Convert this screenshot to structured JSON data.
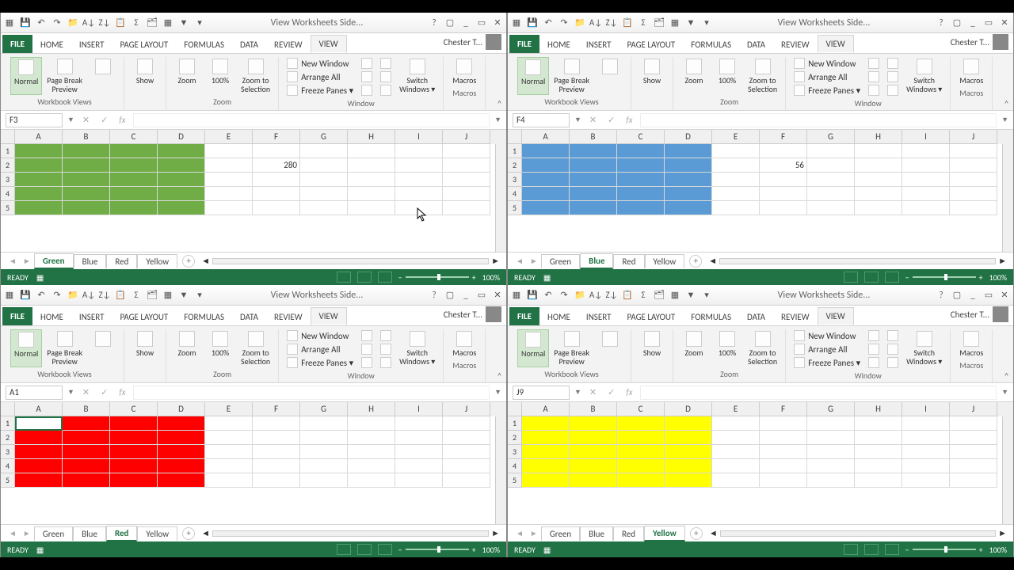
{
  "title_text": "View Worksheets Side...",
  "user_name": "Chester T...",
  "tabs_ribbon": [
    "FILE",
    "HOME",
    "INSERT",
    "PAGE LAYOUT",
    "FORMULAS",
    "DATA",
    "REVIEW",
    "VIEW"
  ],
  "active_ribbon_tab": "VIEW",
  "ribbon": {
    "group_views": "Workbook Views",
    "group_zoom": "Zoom",
    "group_window": "Window",
    "group_macros": "Macros",
    "normal": "Normal",
    "page_break": "Page Break\nPreview",
    "show": "Show",
    "zoom": "Zoom",
    "pct100": "100%",
    "zoom_sel": "Zoom to\nSelection",
    "new_window": "New Window",
    "arrange_all": "Arrange All",
    "freeze": "Freeze Panes",
    "switch": "Switch\nWindows",
    "macros": "Macros"
  },
  "sheet_tabs": [
    "Green",
    "Blue",
    "Red",
    "Yellow"
  ],
  "cols": [
    "A",
    "B",
    "C",
    "D",
    "E",
    "F",
    "G",
    "H",
    "I",
    "J"
  ],
  "rownums": [
    "1",
    "2",
    "3",
    "4",
    "5"
  ],
  "status_ready": "READY",
  "status_zoom": "100%",
  "windows": [
    {
      "namebox": "F3",
      "active_tab": "Green",
      "fill_class": "fill-green",
      "cell_value": "280",
      "value_col": 5,
      "value_row": 1,
      "sel_cell": null
    },
    {
      "namebox": "F4",
      "active_tab": "Blue",
      "fill_class": "fill-blue",
      "cell_value": "56",
      "value_col": 5,
      "value_row": 1,
      "sel_cell": null
    },
    {
      "namebox": "A1",
      "active_tab": "Red",
      "fill_class": "fill-red",
      "cell_value": "",
      "value_col": null,
      "value_row": null,
      "sel_cell": [
        0,
        0
      ]
    },
    {
      "namebox": "J9",
      "active_tab": "Yellow",
      "fill_class": "fill-yellow",
      "cell_value": "",
      "value_col": null,
      "value_row": null,
      "sel_cell": null
    }
  ],
  "chart_data": null
}
